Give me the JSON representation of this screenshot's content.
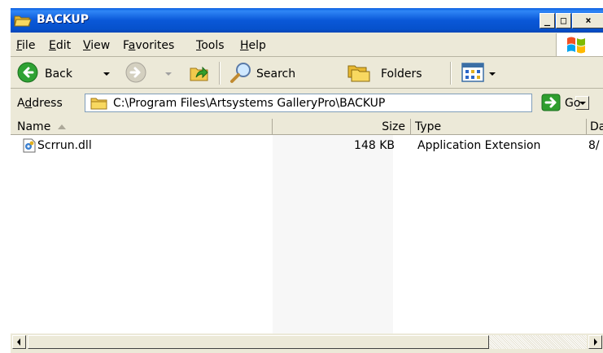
{
  "window": {
    "title": "BACKUP"
  },
  "menu": [
    {
      "label": "File",
      "u": "F",
      "rest": "ile"
    },
    {
      "label": "Edit",
      "u": "E",
      "rest": "dit"
    },
    {
      "label": "View",
      "u": "V",
      "rest": "iew"
    },
    {
      "label": "Favorites",
      "pre": "F",
      "u": "a",
      "rest": "vorites"
    },
    {
      "label": "Tools",
      "u": "T",
      "rest": "ools"
    },
    {
      "label": "Help",
      "u": "H",
      "rest": "elp"
    }
  ],
  "toolbar": {
    "back_label": "Back",
    "search_label": "Search",
    "folders_label": "Folders"
  },
  "address": {
    "label_pre": "A",
    "label_u": "d",
    "label_rest": "dress",
    "value": "C:\\Program Files\\Artsystems GalleryPro\\BACKUP",
    "go_label": "Go"
  },
  "columns": {
    "name": "Name",
    "size": "Size",
    "type": "Type",
    "date": "Da"
  },
  "files": [
    {
      "name": "Scrrun.dll",
      "size": "148 KB",
      "type": "Application Extension",
      "date": "8/"
    }
  ],
  "colors": {
    "titlebar": "#0a58d8",
    "chrome": "#ece9d8",
    "go_green": "#2e9e2e"
  }
}
